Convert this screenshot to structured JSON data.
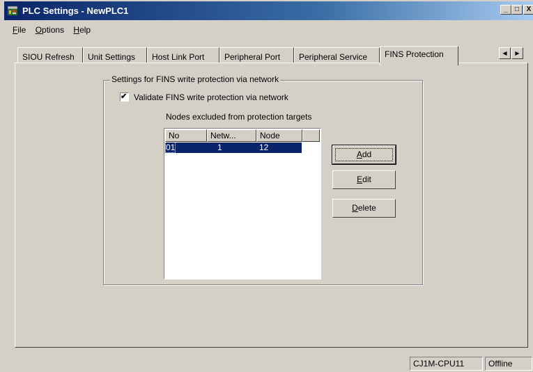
{
  "window": {
    "title": "PLC Settings - NewPLC1",
    "minimize": "_",
    "maximize": "□",
    "close": "X"
  },
  "menu": [
    {
      "label": "File",
      "accel": "F",
      "rest": "ile"
    },
    {
      "label": "Options",
      "accel": "O",
      "rest": "ptions"
    },
    {
      "label": "Help",
      "accel": "H",
      "rest": "elp"
    }
  ],
  "tabs": [
    {
      "label": "SIOU Refresh"
    },
    {
      "label": "Unit Settings"
    },
    {
      "label": "Host Link Port"
    },
    {
      "label": "Peripheral Port"
    },
    {
      "label": "Peripheral Service"
    },
    {
      "label": "FINS Protection",
      "active": true
    }
  ],
  "tab_scroll": {
    "left": "◀",
    "right": "▶"
  },
  "fins": {
    "group_title": "Settings for FINS write protection via network",
    "validate_label": "Validate FINS write protection via network",
    "validate_checked": true,
    "check_mark": "✔",
    "nodes_caption": "Nodes excluded from protection targets",
    "columns": [
      "No",
      "Netw...",
      "Node"
    ],
    "rows": [
      {
        "no": "01",
        "network": "1",
        "node": "12",
        "selected": true
      }
    ],
    "buttons": {
      "add": {
        "accel": "A",
        "rest": "dd"
      },
      "edit": {
        "accel": "E",
        "rest": "dit"
      },
      "delete": {
        "accel": "D",
        "rest": "elete"
      }
    }
  },
  "status": {
    "model": "CJ1M-CPU11",
    "mode": "Offline"
  },
  "colors": {
    "face": "#d4d0c8",
    "title_active": "#0a246a",
    "selection": "#0a246a"
  }
}
